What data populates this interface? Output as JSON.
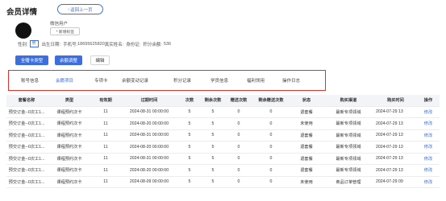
{
  "page": {
    "title": "会员详情",
    "back_label": "返回上一页",
    "back_arrow": "‹"
  },
  "profile": {
    "username": "微信用户",
    "add_tag_icon": "+",
    "add_tag_label": "新增标签",
    "gender_label": "性别:",
    "gender_value": "男",
    "birthday_label": "出生日期:",
    "phone_label": "手机号:",
    "phone_value": "18695625820",
    "realname_label": "真实姓名:",
    "idcard_label": "身份证:",
    "points_label": "积分余额:",
    "points_value": "536"
  },
  "actions": {
    "gift_card_type": "全赠卡类型",
    "balance_adjust": "余额调整",
    "edit": "编辑"
  },
  "tabs": [
    "账号信息",
    "会籍项目",
    "专项卡",
    "余额变动记录",
    "积分记录",
    "学员信息",
    "福利领用",
    "操作日志"
  ],
  "active_tab_index": 1,
  "table": {
    "headers": [
      "套餐名称",
      "类型",
      "有效期",
      "过期时间",
      "次数",
      "剩余次数",
      "赠送次数",
      "剩余赠送次数",
      "状态",
      "购买渠道",
      "购买时间",
      "操作"
    ],
    "rows": [
      [
        "预交订金--0次工1...",
        "课程预约次卡",
        "11",
        "2024-08-31 00:00:00",
        "5",
        "5",
        "0",
        "0",
        "退套餐",
        "最新专项领域",
        "2024-07-29 13",
        "修改"
      ],
      [
        "预交订金--0次工1...",
        "课程预约次卡",
        "11",
        "2024-08-20 00:00:00",
        "5",
        "5",
        "0",
        "0",
        "未使用",
        "最新专项领域",
        "2024-07-29 13",
        "修改"
      ],
      [
        "预交订金--0次工1...",
        "课程预约次卡",
        "11",
        "2024-08-31 00:00:00",
        "5",
        "5",
        "0",
        "0",
        "退套餐",
        "最新专项领域",
        "2024-07-29 13",
        "修改"
      ],
      [
        "预交订金--0次工1...",
        "课程预约次卡",
        "11",
        "2024-08-20 00:00:00",
        "5",
        "5",
        "0",
        "0",
        "退套餐",
        "最新专项领域",
        "2024-07-29 13",
        "修改"
      ],
      [
        "预交订金--0次工1...",
        "课程预约次卡",
        "11",
        "2024-08-31 00:00:00",
        "5",
        "5",
        "0",
        "0",
        "退套餐",
        "最新专项领域",
        "2024-07-29 13",
        "修改"
      ],
      [
        "预交订金--0次工1...",
        "课程预约次卡",
        "11",
        "2024-08-20 00:00:00",
        "5",
        "5",
        "0",
        "0",
        "退套餐",
        "最新专项领域",
        "2024-07-29 13",
        "修改"
      ],
      [
        "预交订金--0次工1...",
        "课程预约次卡",
        "11",
        "2024-08-09 00:00:00",
        "5",
        "5",
        "0",
        "0",
        "未使用",
        "商品订单管理",
        "2024-07-29 09",
        "修改"
      ]
    ]
  },
  "colors": {
    "accent": "#3b6fe0",
    "highlight_border": "#e0332d"
  }
}
